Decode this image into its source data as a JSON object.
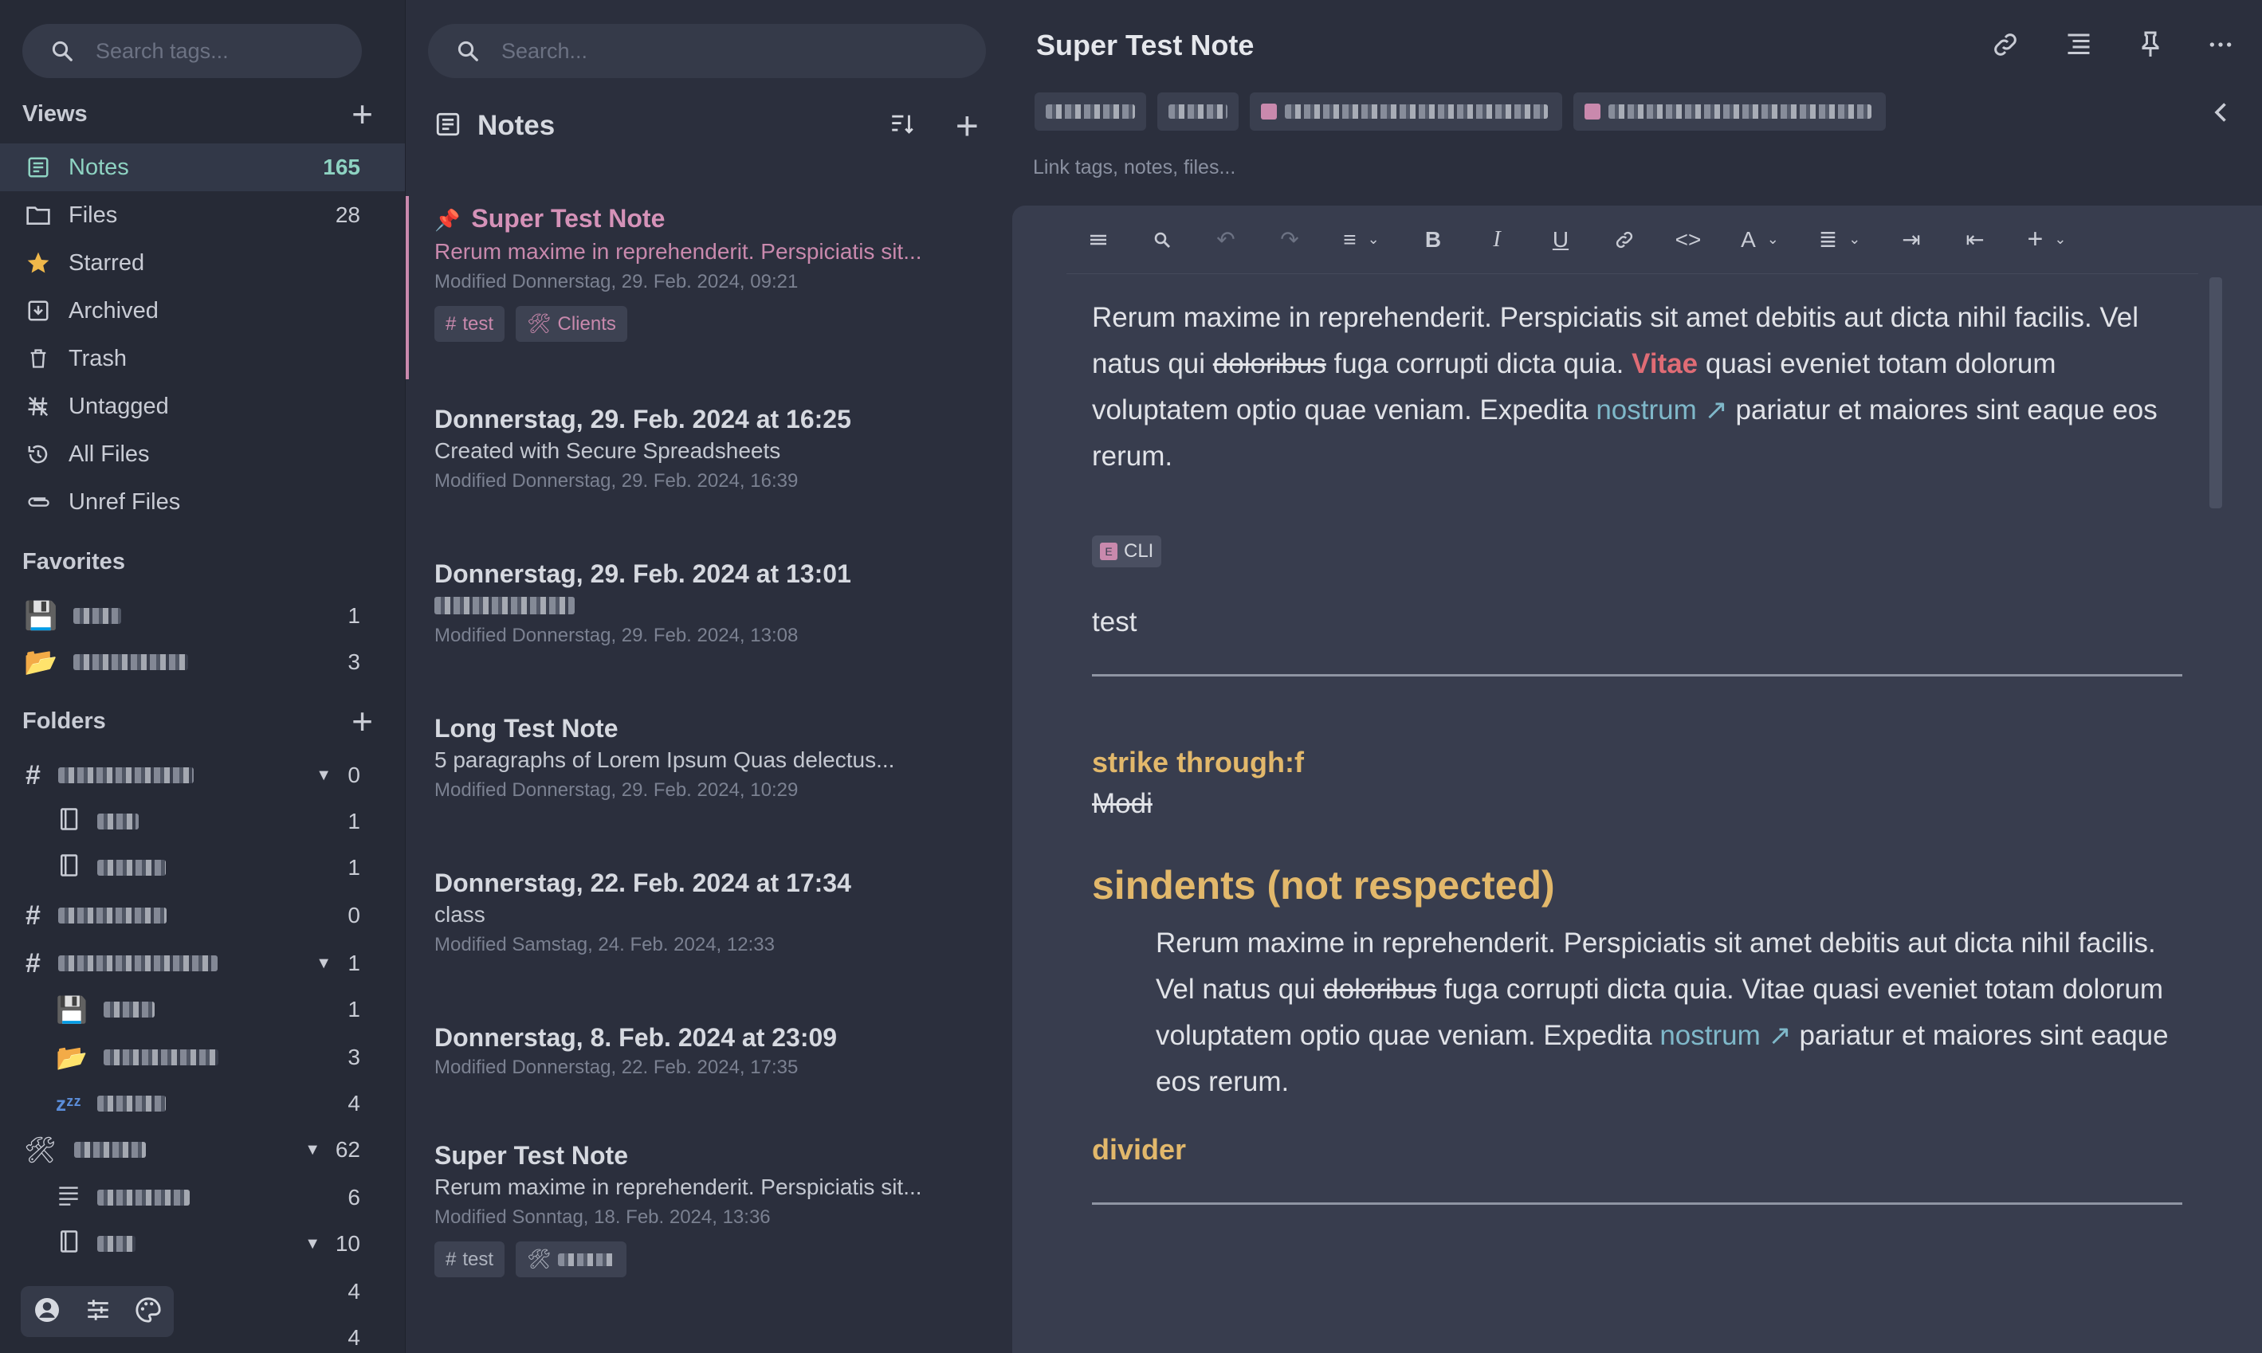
{
  "sidebar": {
    "search_placeholder": "Search tags...",
    "views_heading": "Views",
    "views": [
      {
        "label": "Notes",
        "count": "165",
        "icon": "notes-icon"
      },
      {
        "label": "Files",
        "count": "28",
        "icon": "folder-icon"
      },
      {
        "label": "Starred",
        "count": "",
        "icon": "star-icon"
      },
      {
        "label": "Archived",
        "count": "",
        "icon": "archive-icon"
      },
      {
        "label": "Trash",
        "count": "",
        "icon": "trash-icon"
      },
      {
        "label": "Untagged",
        "count": "",
        "icon": "untagged-icon"
      },
      {
        "label": "All Files",
        "count": "",
        "icon": "history-icon"
      },
      {
        "label": "Unref Files",
        "count": "",
        "icon": "paperclip-icon"
      }
    ],
    "favorites_heading": "Favorites",
    "favorites": [
      {
        "count": "1",
        "icon": "floppy-icon"
      },
      {
        "count": "3",
        "icon": "folder-open-icon"
      }
    ],
    "folders_heading": "Folders",
    "folders": [
      {
        "count": "0",
        "icon": "hash-icon",
        "expanded": true
      },
      {
        "count": "1",
        "icon": "notebook-icon"
      },
      {
        "count": "1",
        "icon": "notebook-icon"
      },
      {
        "count": "0",
        "icon": "hash-icon"
      },
      {
        "count": "1",
        "icon": "hash-icon",
        "expanded": true
      },
      {
        "count": "1",
        "icon": "floppy-icon"
      },
      {
        "count": "3",
        "icon": "folder-open-icon"
      },
      {
        "count": "4",
        "icon": "sleep-icon"
      },
      {
        "count": "62",
        "icon": "tools-icon",
        "expanded": true
      },
      {
        "count": "6",
        "icon": "lines-icon"
      },
      {
        "count": "10",
        "icon": "notebook-icon",
        "expanded": true
      },
      {
        "count": "4",
        "icon": ""
      },
      {
        "count": "4",
        "icon": ""
      }
    ]
  },
  "notes_list": {
    "search_placeholder": "Search...",
    "title": "Notes",
    "notes": [
      {
        "title": "Super Test Note",
        "snippet": "Rerum maxime in reprehenderit. Perspiciatis sit...",
        "meta": "Modified Donnerstag, 29. Feb. 2024, 09:21",
        "tags": [
          "test",
          "Clients"
        ]
      },
      {
        "title": "Donnerstag, 29. Feb. 2024 at 16:25",
        "snippet": "Created with Secure Spreadsheets",
        "meta": "Modified Donnerstag, 29. Feb. 2024, 16:39"
      },
      {
        "title": "Donnerstag, 29. Feb. 2024 at 13:01",
        "snippet": "",
        "meta": "Modified Donnerstag, 29. Feb. 2024, 13:08"
      },
      {
        "title": "Long Test Note",
        "snippet": "5 paragraphs of Lorem Ipsum Quas delectus...",
        "meta": "Modified Donnerstag, 29. Feb. 2024, 10:29"
      },
      {
        "title": "Donnerstag, 22. Feb. 2024 at 17:34",
        "snippet": "class",
        "meta": "Modified Samstag, 24. Feb. 2024, 12:33"
      },
      {
        "title": "Donnerstag, 8. Feb. 2024 at 23:09",
        "snippet": "",
        "meta": "Modified Donnerstag, 22. Feb. 2024, 17:35"
      },
      {
        "title": "Super Test Note",
        "snippet": "Rerum maxime in reprehenderit. Perspiciatis sit...",
        "meta": "Modified Sonntag, 18. Feb. 2024, 13:36",
        "tags": [
          "test",
          ""
        ]
      }
    ]
  },
  "editor": {
    "title": "Super Test Note",
    "link_hint": "Link tags, notes, files...",
    "para1_a": "Rerum maxime in reprehenderit. Perspiciatis sit amet debitis aut dicta nihil facilis. Vel natus qui ",
    "para1_strike": "doloribus",
    "para1_b": " fuga corrupti dicta quia. ",
    "para1_red": "Vitae",
    "para1_c": " quasi eveniet totam dolorum voluptatem optio quae veniam. Expedita ",
    "para1_link": "nostrum ↗",
    "para1_d": " pariatur et maiores sint eaque eos rerum.",
    "cli_label": "CLI",
    "test_line": "test",
    "h_strike": "strike through:f",
    "strike_text": "Modi",
    "h_indents": "sindents (not respected)",
    "para2_a": "Rerum maxime in reprehenderit. Perspiciatis sit amet debitis aut dicta nihil facilis. Vel natus qui ",
    "para2_strike": "doloribus",
    "para2_b": " fuga corrupti dicta quia. Vitae quasi eveniet totam dolorum voluptatem optio quae veniam. Expedita ",
    "para2_link": "nostrum ↗",
    "para2_c": " pariatur et maiores sint eaque eos rerum.",
    "h_divider": "divider"
  },
  "colors": {
    "accent_teal": "#8ed3c2",
    "accent_pink": "#d592b8",
    "heading_yellow": "#e2b86b",
    "emphasis_red": "#e06c75",
    "link_blue": "#7fb8c9"
  }
}
